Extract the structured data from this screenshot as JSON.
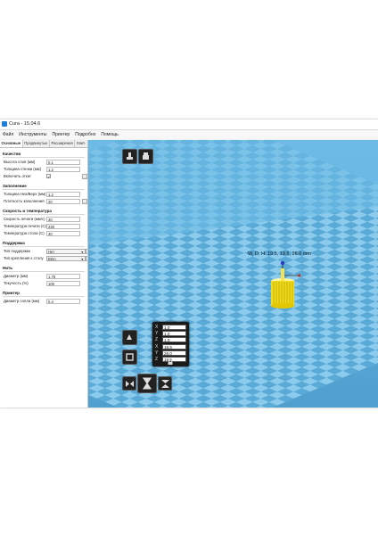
{
  "window": {
    "title": "Cura - 15.04.6"
  },
  "menu": [
    "Файл",
    "Инструменты",
    "Принтер",
    "Подробно",
    "Помощь"
  ],
  "tabs": [
    "Основные",
    "Продвинутые",
    "Расширения",
    "Start-"
  ],
  "sections": {
    "quality": {
      "title": "Качество",
      "layer_height": {
        "label": "Высота слоя (мм)",
        "value": "0.1"
      },
      "shell": {
        "label": "Толщина стенки (мм)",
        "value": "1.2"
      },
      "retraction": {
        "label": "Включить откат",
        "checked": "✓"
      }
    },
    "fill": {
      "title": "Заполнение",
      "bottom_top": {
        "label": "Толщина Низ/Верх (мм)",
        "value": "1.2"
      },
      "density": {
        "label": "Плотность заполнения",
        "value": "20"
      }
    },
    "speed": {
      "title": "Скорость и температура",
      "print_speed": {
        "label": "Скорость печати (мм/с)",
        "value": "40"
      },
      "print_temp": {
        "label": "Температура печати (C)",
        "value": "230"
      },
      "bed_temp": {
        "label": "Температура стола (C)",
        "value": "40"
      }
    },
    "support": {
      "title": "Поддержка",
      "support_type": {
        "label": "Тип поддержки",
        "value": "Нет"
      },
      "platform": {
        "label": "Тип крепления к столу",
        "value": "Brim"
      }
    },
    "filament": {
      "title": "Нить",
      "diameter": {
        "label": "Диаметр (мм)",
        "value": "1.75"
      },
      "flow": {
        "label": "Текучесть (%)",
        "value": "100"
      }
    },
    "machine": {
      "title": "Принтер",
      "nozzle": {
        "label": "Диаметр сопла (мм)",
        "value": "0.4"
      }
    }
  },
  "viewport": {
    "dims_text": "W, D, H: 19.5, 19.5, 26.0 mm",
    "scale": [
      {
        "axis": "X",
        "value": "1.0"
      },
      {
        "axis": "Y",
        "value": "1.0"
      },
      {
        "axis": "Z",
        "value": "1.0"
      }
    ],
    "size": [
      {
        "axis": "X",
        "value": "19.5"
      },
      {
        "axis": "Y",
        "value": "26.0"
      },
      {
        "axis": "Z",
        "value": "19.5"
      }
    ],
    "model_color": "#f0dc1e",
    "grid_color": "#7fc3e6"
  }
}
